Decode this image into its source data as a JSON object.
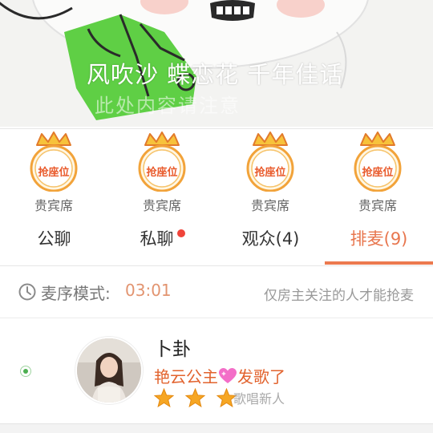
{
  "banner": {
    "text": "风吹沙 蝶恋花 千年佳话",
    "subtext": "此处内容请注意"
  },
  "seats": [
    {
      "button_label": "抢座位",
      "label": "贵宾席"
    },
    {
      "button_label": "抢座位",
      "label": "贵宾席"
    },
    {
      "button_label": "抢座位",
      "label": "贵宾席"
    },
    {
      "button_label": "抢座位",
      "label": "贵宾席"
    }
  ],
  "tabs": [
    {
      "label": "公聊",
      "active": false
    },
    {
      "label": "私聊",
      "active": false,
      "has_unread_dot": true
    },
    {
      "label": "观众(4)",
      "active": false
    },
    {
      "label": "排麦(9)",
      "active": true
    }
  ],
  "mode_bar": {
    "label": "麦序模式:",
    "time": "03:01",
    "note": "仅房主关注的人才能抢麦"
  },
  "queue": [
    {
      "name": "卜卦",
      "song_prefix": "艳云公主",
      "song_suffix": "发歌了",
      "stars": 3,
      "rank_label": "歌唱新人",
      "selected": true
    }
  ],
  "colors": {
    "accent": "#ec7a4f",
    "seat_orange": "#e95a2b",
    "crown_yellow": "#f7c23b",
    "online_green": "#4caf50"
  }
}
